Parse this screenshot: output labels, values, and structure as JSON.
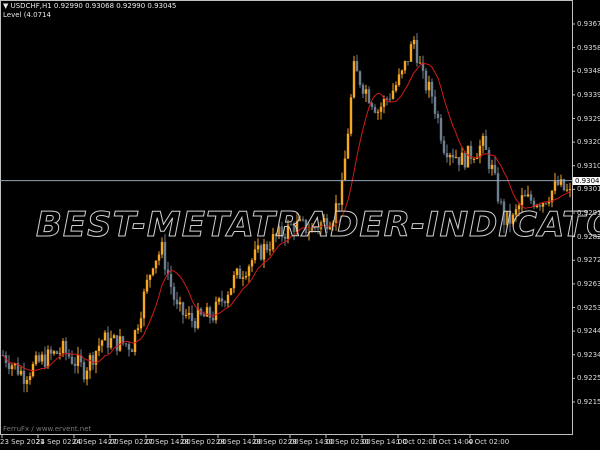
{
  "header": {
    "symbol_line": "▼ USDCHF,H1  0.92990 0.93068 0.92990 0.93045",
    "level_line": "Level (4.0714"
  },
  "credit": "FerruFx / www.ervent.net",
  "watermark": "BEST-METATRADER-INDICATORS.COM",
  "colors": {
    "bull": "#f5a623",
    "bear": "#6e7f91",
    "ma": "#d11a1a",
    "level": "#8fa4b8",
    "grid": "#c0c0c0"
  },
  "chart_data": {
    "type": "candlestick",
    "symbol": "USDCHF",
    "timeframe": "H1",
    "ylim": [
      0.9211,
      0.9372
    ],
    "y_ticks": [
      "0.93675",
      "0.93580",
      "0.93485",
      "0.93390",
      "0.93295",
      "0.93200",
      "0.93105",
      "0.93010",
      "0.92915",
      "0.92820",
      "0.92725",
      "0.92630",
      "0.92535",
      "0.92440",
      "0.92345",
      "0.92250",
      "0.92155"
    ],
    "x_ticks": [
      "23 Sep 2021",
      "24 Sep 02:00",
      "24 Sep 14:00",
      "27 Sep 02:00",
      "27 Sep 14:00",
      "28 Sep 02:00",
      "28 Sep 14:00",
      "29 Sep 02:00",
      "29 Sep 14:00",
      "30 Sep 02:00",
      "30 Sep 14:00",
      "1 Oct 02:00",
      "1 Oct 14:00",
      "4 Oct 02:00"
    ],
    "bars_per_tick": 12,
    "candle_count": 190,
    "level_value": "0.93045",
    "price_path": [
      [
        0,
        0.92344
      ],
      [
        7,
        0.92264
      ],
      [
        13,
        0.92324
      ],
      [
        20,
        0.92364
      ],
      [
        27,
        0.92284
      ],
      [
        33,
        0.92405
      ],
      [
        43,
        0.92385
      ],
      [
        50,
        0.92726
      ],
      [
        53,
        0.92766
      ],
      [
        58,
        0.92525
      ],
      [
        63,
        0.92485
      ],
      [
        70,
        0.92505
      ],
      [
        77,
        0.92646
      ],
      [
        83,
        0.92726
      ],
      [
        90,
        0.92807
      ],
      [
        97,
        0.92867
      ],
      [
        103,
        0.92847
      ],
      [
        110,
        0.92907
      ],
      [
        113,
        0.93008
      ],
      [
        117,
        0.9349
      ],
      [
        120,
        0.9343
      ],
      [
        125,
        0.93329
      ],
      [
        130,
        0.9341
      ],
      [
        133,
        0.9347
      ],
      [
        137,
        0.93611
      ],
      [
        140,
        0.9345
      ],
      [
        143,
        0.9339
      ],
      [
        147,
        0.93189
      ],
      [
        153,
        0.93128
      ],
      [
        160,
        0.93189
      ],
      [
        163,
        0.93088
      ],
      [
        167,
        0.92887
      ],
      [
        170,
        0.92887
      ],
      [
        173,
        0.92967
      ],
      [
        180,
        0.92967
      ],
      [
        185,
        0.93028
      ],
      [
        189,
        0.92988
      ]
    ]
  }
}
